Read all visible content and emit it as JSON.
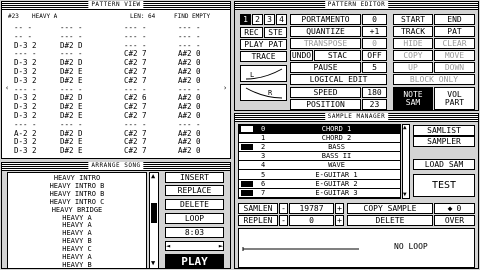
{
  "pattern_view": {
    "title": "PATTERN VIEW",
    "header": {
      "pos": "#23",
      "name": "HEAVY A",
      "length": "LEN: 64",
      "find_empty": "FIND EMPTY"
    },
    "rows": [
      {
        "l": "-- -",
        "m": "--- -",
        "r": "--- -"
      },
      {
        "l": "-- -",
        "m": "--- -",
        "r": "--- -"
      },
      {
        "l": "D-3 2",
        "m": "D#2 D",
        "r": "--- -"
      },
      {
        "l": "--- -",
        "m": "--- -",
        "r": "C#2 7"
      },
      {
        "l": "D-3 2",
        "m": "D#2 D",
        "r": "C#2 7"
      },
      {
        "l": "D-3 2",
        "m": "D#2 E",
        "r": "C#2 7"
      },
      {
        "l": "D-3 2",
        "m": "D#2 E",
        "r": "C#2 7"
      },
      {
        "l": "--- -",
        "m": "--- -",
        "r": "--- -"
      },
      {
        "l": "D-3 2",
        "m": "D#2 D",
        "r": "C#2 6"
      },
      {
        "l": "D-3 2",
        "m": "D#2 E",
        "r": "C#2 7"
      },
      {
        "l": "D-3 2",
        "m": "D#2 E",
        "r": "C#2 7"
      },
      {
        "l": "--- -",
        "m": "--- -",
        "r": "--- -"
      },
      {
        "l": "A-2 2",
        "m": "D#2 D",
        "r": "C#2 7"
      },
      {
        "l": "D-3 2",
        "m": "D#2 E",
        "r": "C#2 7"
      },
      {
        "l": "D-3 2",
        "m": "D#2 E",
        "r": "C#2 7"
      }
    ],
    "right_col": [
      "--- -",
      "--- -",
      "--- -",
      "A#2 0",
      "A#2 0",
      "A#2 0",
      "A#2 0",
      "--- -",
      "A#2 0",
      "A#2 0",
      "A#2 0",
      "--- -",
      "A#2 0",
      "A#2 0",
      "A#2 0"
    ]
  },
  "pattern_editor": {
    "title": "PATTERN EDITOR",
    "tracks": [
      "1",
      "2",
      "3",
      "4"
    ],
    "rec": "REC",
    "ste": "STE",
    "play_pat": "PLAY PAT",
    "trace": "TRACE",
    "portamento_label": "PORTAMENTO",
    "portamento_val": "0",
    "quantize_label": "QUANTIZE",
    "quantize_val": "+1",
    "transpose_label": "TRANSPOSE",
    "transpose_val": "0",
    "undo": "UNDO",
    "stac": "STAC",
    "off": "OFF",
    "pause_label": "PAUSE",
    "pause_val": "5",
    "logical_edit": "LOGICAL EDIT",
    "speed_label": "SPEED",
    "speed_val": "180",
    "position_label": "POSITION",
    "position_val": "23",
    "note": "NOTE",
    "sam": "SAM",
    "vol": "VOL",
    "part": "PART",
    "l_label": "L",
    "r_label": "R",
    "start": "START",
    "end": "END",
    "track": "TRACK",
    "pat": "PAT",
    "hide": "HIDE",
    "clear": "CLEAR",
    "copy": "COPY",
    "move": "MOVE",
    "up": "UP",
    "down": "DOWN",
    "block_only": "BLOCK ONLY"
  },
  "arrange": {
    "title": "ARRANGE SONG",
    "songs": [
      "HEAVY INTRO",
      "HEAVY INTRO B",
      "HEAVY INTRO B",
      "HEAVY INTRO C",
      "HEAVY BRIDGE",
      "HEAVY A",
      "HEAVY A",
      "HEAVY A",
      "HEAVY B",
      "HEAVY C",
      "HEAVY A",
      "HEAVY B"
    ],
    "insert": "INSERT",
    "replace": "REPLACE",
    "delete": "DELETE",
    "loop": "LOOP",
    "counter": "8:03",
    "play": "PLAY"
  },
  "sample_manager": {
    "title": "SAMPLE MANAGER",
    "samples": [
      {
        "n": "0",
        "name": "CHORD 1",
        "sel": true,
        "blk": true
      },
      {
        "n": "1",
        "name": "CHORD 2",
        "sel": false,
        "blk": false
      },
      {
        "n": "2",
        "name": "BASS",
        "sel": false,
        "blk": true
      },
      {
        "n": "3",
        "name": "BASS II",
        "sel": false,
        "blk": false
      },
      {
        "n": "4",
        "name": "WAVE",
        "sel": false,
        "blk": false
      },
      {
        "n": "5",
        "name": "E-GUITAR 1",
        "sel": false,
        "blk": false
      },
      {
        "n": "6",
        "name": "E-GUITAR 2",
        "sel": false,
        "blk": true
      },
      {
        "n": "7",
        "name": "E-GUITAR 3",
        "sel": false,
        "blk": true
      }
    ],
    "samlist": "SAMLIST",
    "sampler": "SAMPLER",
    "load_sam": "LOAD SAM",
    "test": "TEST",
    "samlen_label": "SAMLEN",
    "samlen_val": "19787",
    "replen_label": "REPLEN",
    "replen_val": "0",
    "copy_sample": "COPY SAMPLE",
    "copy_val": "0",
    "delete": "DELETE",
    "over": "OVER",
    "no_loop": "NO LOOP"
  }
}
